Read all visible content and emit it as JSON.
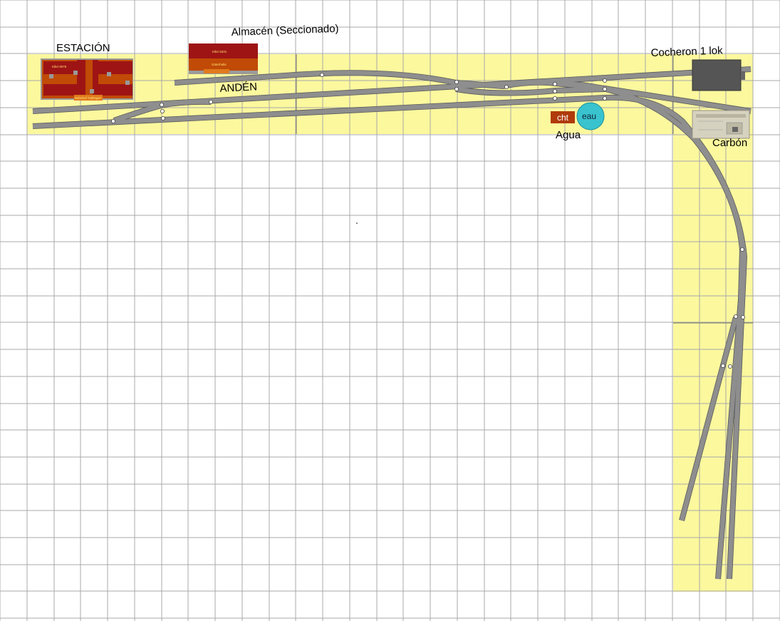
{
  "labels": {
    "station": "ESTACIÓN",
    "warehouse": "Almacén (Seccionado)",
    "platform": "ANDÉN",
    "engine_shed": "Cocheron 1 lok",
    "water": "Agua",
    "coal": "Carbón"
  },
  "buildings": {
    "station_sign_top": "Kibri 9075",
    "station_sign_bottom": "Bahnhof Tuttlingen",
    "warehouse_sign_top": "Kibri 8331",
    "warehouse_sign_bottom": "Güterhalle",
    "water_crane": "cht",
    "water_tower": "eau"
  },
  "colors": {
    "board": "#fbf89e",
    "grid": "#a8a8a8",
    "track": "#8e8e8e",
    "track_edge": "#5c5c5c",
    "station_roof": "#9e1414",
    "station_wall": "#c04a06",
    "water_tower": "#38c3cf",
    "engine_shed": "#555555"
  }
}
